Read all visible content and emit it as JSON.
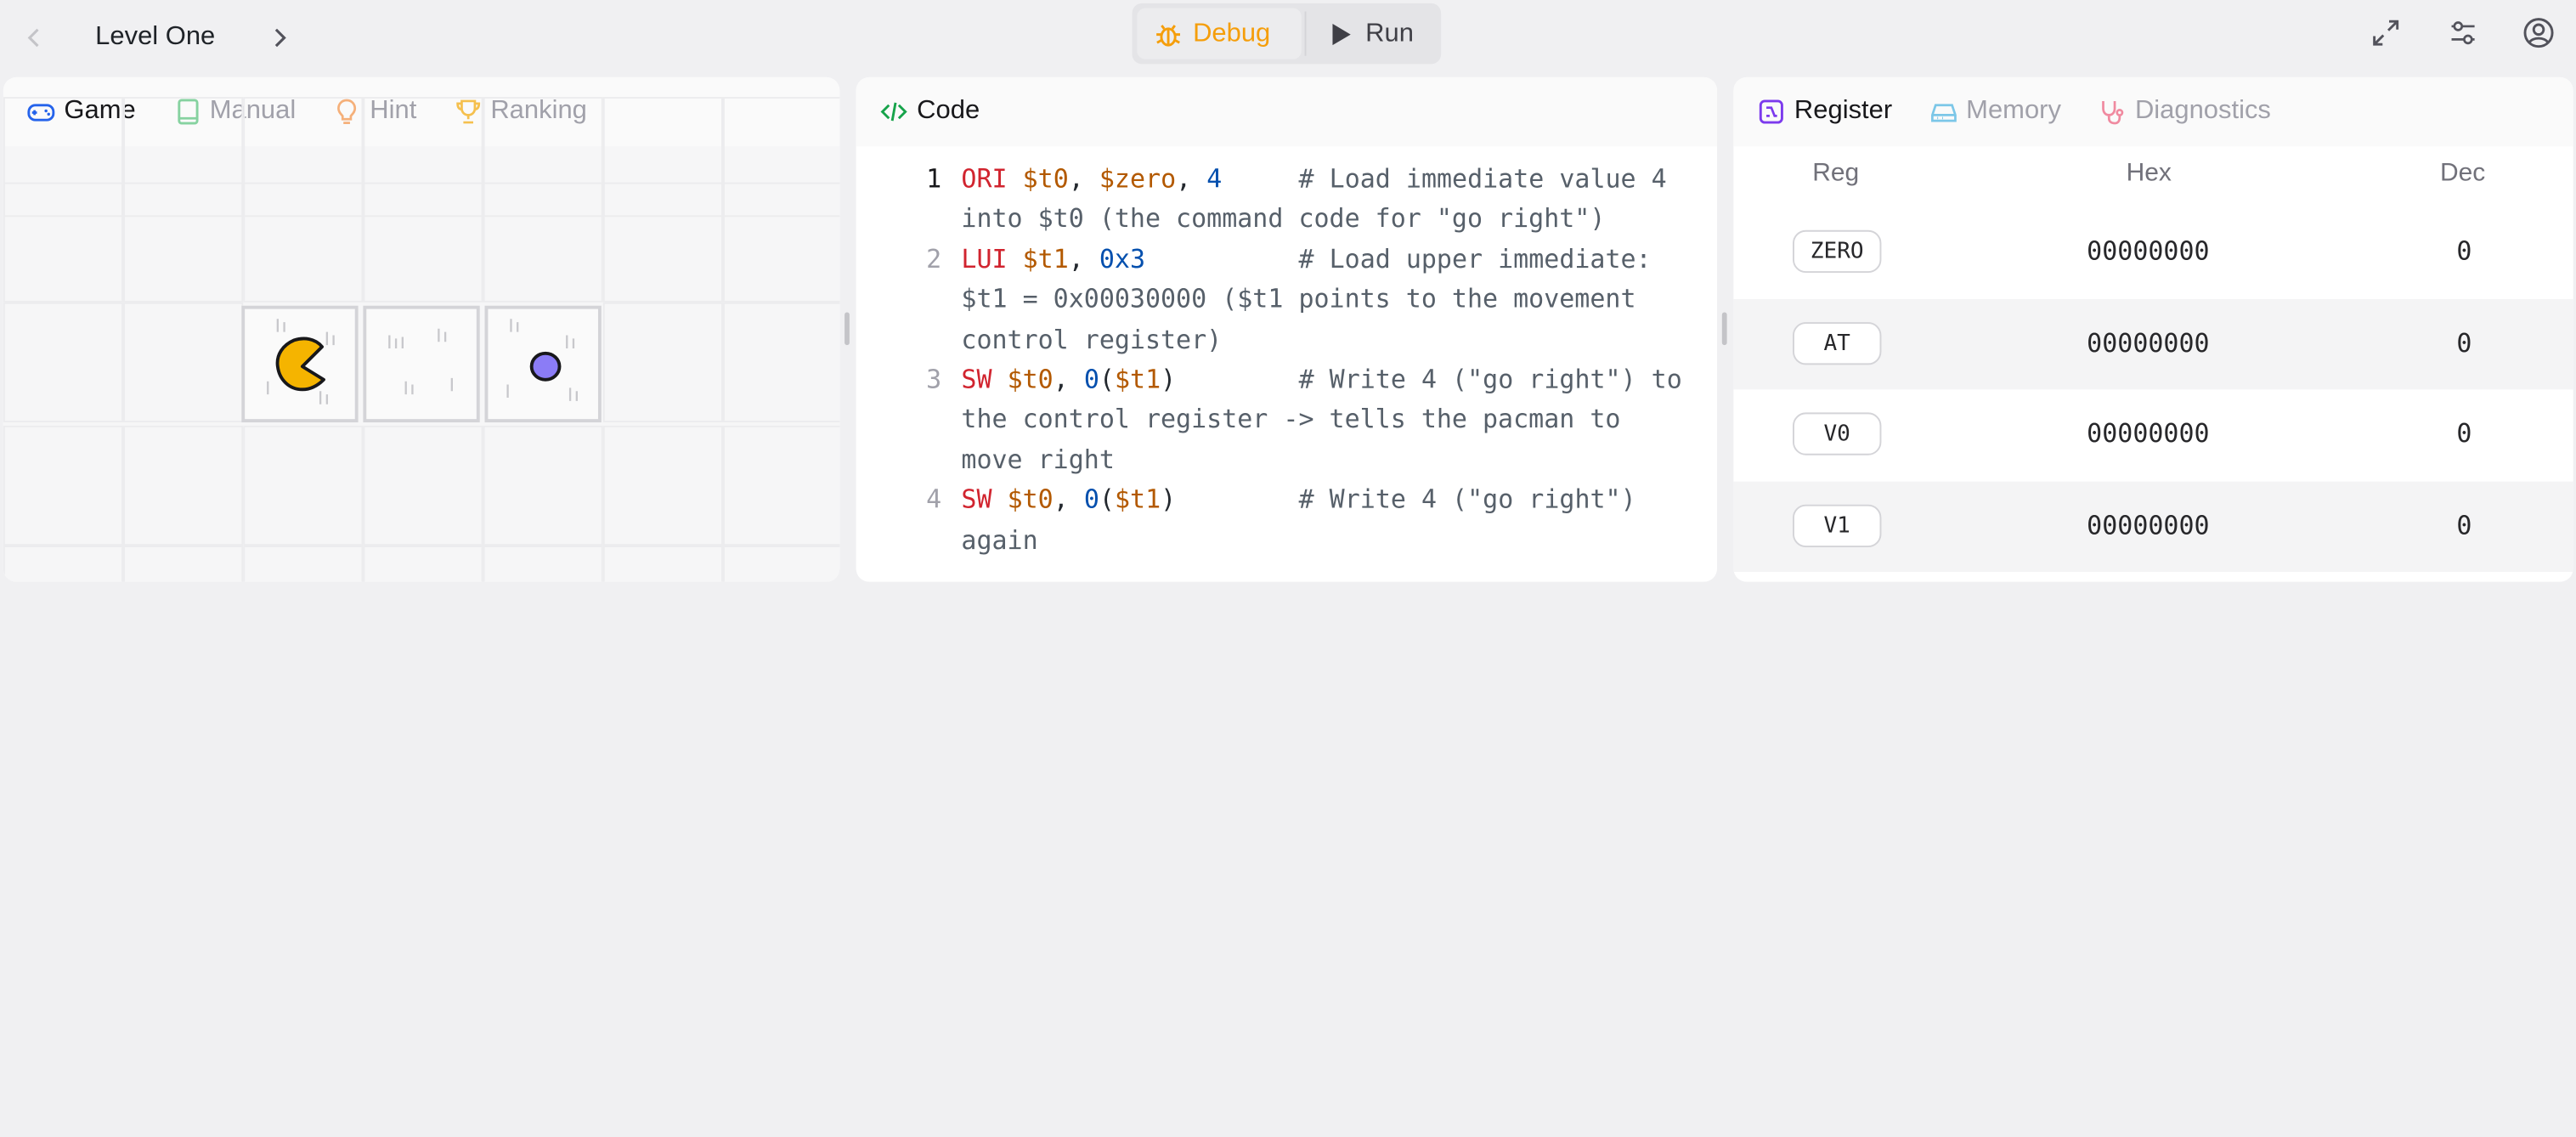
{
  "topbar": {
    "title": "Level One",
    "debug_label": "Debug",
    "run_label": "Run"
  },
  "game_panel": {
    "tabs": [
      "Game",
      "Manual",
      "Hint",
      "Ranking"
    ]
  },
  "code_panel": {
    "title": "Code",
    "lines": [
      {
        "n": "1",
        "parts": [
          [
            "kw",
            "ORI"
          ],
          [
            "pn",
            " "
          ],
          [
            "reg",
            "$t0"
          ],
          [
            "pn",
            ", "
          ],
          [
            "reg",
            "$zero"
          ],
          [
            "pn",
            ", "
          ],
          [
            "num",
            "4"
          ],
          [
            "cm",
            "     # Load immediate value 4 into $t0 (the command code for \"go right\")"
          ]
        ]
      },
      {
        "n": "2",
        "parts": [
          [
            "kw",
            "LUI"
          ],
          [
            "pn",
            " "
          ],
          [
            "reg",
            "$t1"
          ],
          [
            "pn",
            ", "
          ],
          [
            "num",
            "0x3"
          ],
          [
            "cm",
            "          # Load upper immediate: $t1 = 0x00030000 ($t1 points to the movement control register)"
          ]
        ]
      },
      {
        "n": "3",
        "parts": [
          [
            "kw",
            "SW"
          ],
          [
            "pn",
            " "
          ],
          [
            "reg",
            "$t0"
          ],
          [
            "pn",
            ", "
          ],
          [
            "num",
            "0"
          ],
          [
            "pn",
            "("
          ],
          [
            "reg",
            "$t1"
          ],
          [
            "pn",
            ")"
          ],
          [
            "cm",
            "        # Write 4 (\"go right\") to the control register -> tells the pacman to move right"
          ]
        ]
      },
      {
        "n": "4",
        "parts": [
          [
            "kw",
            "SW"
          ],
          [
            "pn",
            " "
          ],
          [
            "reg",
            "$t0"
          ],
          [
            "pn",
            ", "
          ],
          [
            "num",
            "0"
          ],
          [
            "pn",
            "("
          ],
          [
            "reg",
            "$t1"
          ],
          [
            "pn",
            ")"
          ],
          [
            "cm",
            "        # Write 4 (\"go right\") again"
          ]
        ]
      }
    ]
  },
  "register_panel": {
    "tabs": [
      "Register",
      "Memory",
      "Diagnostics"
    ],
    "columns": [
      "Reg",
      "Hex",
      "Dec"
    ],
    "rows": [
      {
        "reg": "ZERO",
        "hex": "00000000",
        "dec": "0"
      },
      {
        "reg": "AT",
        "hex": "00000000",
        "dec": "0"
      },
      {
        "reg": "V0",
        "hex": "00000000",
        "dec": "0"
      },
      {
        "reg": "V1",
        "hex": "00000000",
        "dec": "0"
      }
    ]
  },
  "colors": {
    "debug_accent": "#f59e0b",
    "pacman": "#f5b400",
    "ghost_dot": "#8b7cf6",
    "keyword": "#d1242f",
    "register": "#b35900",
    "number": "#0550ae"
  },
  "icons": {
    "topbar": [
      "chevron-left-icon",
      "chevron-right-icon",
      "bug-icon",
      "play-icon",
      "expand-icon",
      "sliders-icon",
      "user-circle-icon"
    ],
    "game_tabs": [
      "gamepad-icon",
      "book-icon",
      "lightbulb-icon",
      "trophy-icon"
    ],
    "code": "code-icon",
    "register_tabs": [
      "chip-icon",
      "memory-icon",
      "stethoscope-icon"
    ]
  }
}
